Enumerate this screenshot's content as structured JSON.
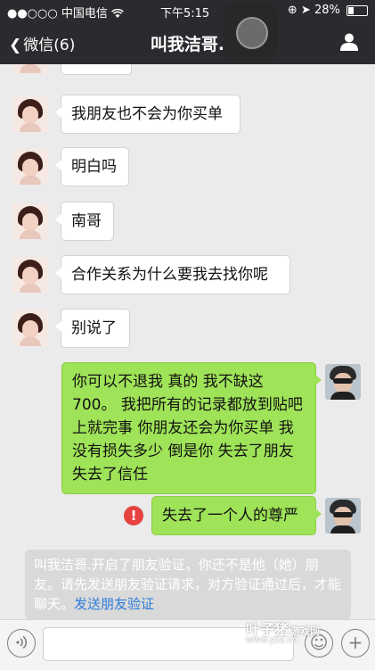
{
  "status_bar": {
    "signal": "●●○○○",
    "carrier": "中国电信",
    "time": "下午5:15",
    "battery": "28%",
    "battery_level_percent": 28
  },
  "nav": {
    "back_label": "微信(6)",
    "title": "叫我洁哥."
  },
  "messages": [
    {
      "side": "in",
      "text": "我朋友也不会为你买单"
    },
    {
      "side": "in",
      "text": "明白吗"
    },
    {
      "side": "in",
      "text": "南哥"
    },
    {
      "side": "in",
      "text": "合作关系为什么要我去找你呢"
    },
    {
      "side": "in",
      "text": "别说了"
    },
    {
      "side": "out",
      "text": "你可以不退我 真的 我不缺这700。 我把所有的记录都放到贴吧上就完事 你朋友还会为你买单 我没有损失多少 倒是你 失去了朋友 失去了信任"
    },
    {
      "side": "out",
      "text": "失去了一个人的尊严",
      "failed": true
    }
  ],
  "system_notice": {
    "text": "叫我洁哥.开启了朋友验证，你还不是他（她）朋友。请先发送朋友验证请求，对方验证通过后，才能聊天。",
    "link": "发送朋友验证"
  },
  "input_bar": {
    "value": ""
  },
  "watermark": {
    "name": "叶子猪",
    "sub": "游戏网",
    "url": "www.yzz.cn"
  },
  "colors": {
    "nav_bg": "#2b2b2f",
    "chat_bg": "#ebebeb",
    "out_bubble": "#9fe358",
    "in_bubble": "#ffffff",
    "error": "#e64340",
    "link": "#2d7ddb"
  }
}
